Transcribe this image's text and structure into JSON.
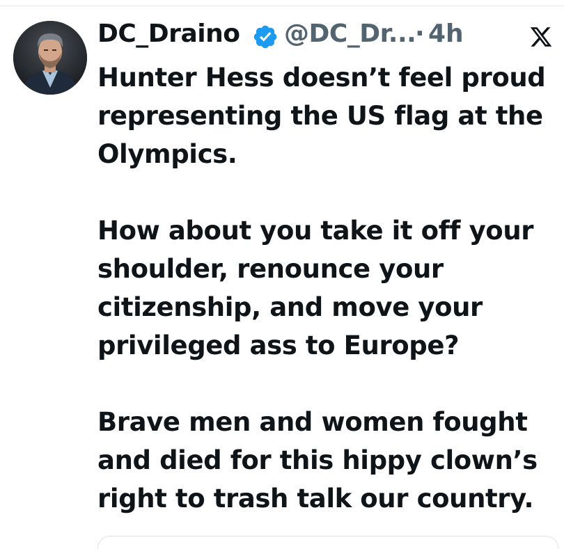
{
  "tweet": {
    "display_name": "DC_Draino",
    "handle": "@DC_Dr...",
    "separator": "·",
    "timestamp": "4h",
    "verified": true,
    "paragraphs": [
      "Hunter Hess doesn’t feel proud representing the US flag at the Olympics.",
      "How about you take it off your shoulder, renounce your citizenship, and move your privileged ass to Europe?",
      "Brave men and women fought and died for this hippy clown’s right to trash talk our country."
    ]
  },
  "icons": {
    "avatar": "profile-photo",
    "verified": "verified-badge-icon",
    "platform": "x-logo-icon"
  },
  "colors": {
    "text": "#0f1419",
    "secondary_text": "#536471",
    "verified_blue": "#1d9bf0",
    "background": "#ffffff"
  }
}
